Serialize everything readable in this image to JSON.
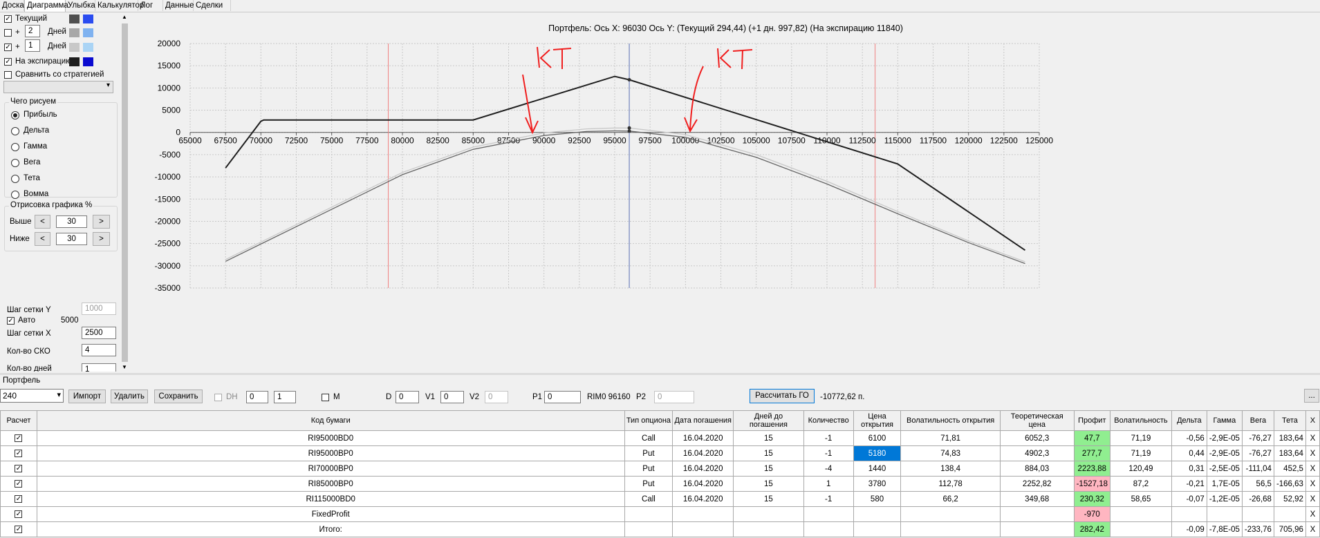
{
  "tabs": [
    "Доска",
    "Диаграмма",
    "Улыбка",
    "Калькулятор",
    "Лог",
    "Данные",
    "Сделки"
  ],
  "active_tab": "Диаграмма",
  "left": {
    "current_label": "Текущий",
    "plus": "+",
    "days_label": "Дней",
    "days1": "2",
    "days2": "1",
    "expiry_label": "На экспирацию",
    "compare_label": "Сравнить со стратегией",
    "what_title": "Чего рисуем",
    "radios": [
      "Прибыль",
      "Дельта",
      "Гамма",
      "Вега",
      "Тета",
      "Вомма"
    ],
    "draw_title": "Отрисовка графика %",
    "above_label": "Выше",
    "below_label": "Ниже",
    "above_value": "30",
    "below_value": "30",
    "left_arrow": "<",
    "right_arrow": ">",
    "grid_y_label": "Шаг сетки Y",
    "grid_y_value": "1000",
    "auto_label": "Авто",
    "auto_value": "5000",
    "grid_x_label": "Шаг сетки X",
    "grid_x_value": "2500",
    "sko_label": "Кол-во СКО",
    "sko_value": "4",
    "days_count_label": "Кол-во дней",
    "days_count_value": "1",
    "colors": {
      "current_dark": "#505050",
      "current_light": "#2a4cf0",
      "days2_dark": "#a8a8a8",
      "days2_light": "#7fb2f0",
      "days1_dark": "#c8c8c8",
      "days1_light": "#aad4f5",
      "expiry_dark": "#1e1e1e",
      "expiry_light": "#0a0ad0"
    }
  },
  "chart": {
    "title": "Портфель: Ось X: 96030 Ось Y:  (Текущий 294,44)  (+1 дн. 997,82)  (На экспирацию 11840)",
    "annotations": [
      "KT",
      "KT"
    ]
  },
  "chart_data": {
    "type": "line",
    "xlim": [
      65000,
      125000
    ],
    "ylim": [
      -35000,
      20000
    ],
    "x_ticks": [
      65000,
      67500,
      70000,
      72500,
      75000,
      77500,
      80000,
      82500,
      85000,
      87500,
      90000,
      92500,
      95000,
      97500,
      100000,
      102500,
      105000,
      107500,
      110000,
      112500,
      115000,
      117500,
      120000,
      122500,
      125000
    ],
    "y_ticks": [
      20000,
      15000,
      10000,
      5000,
      0,
      -5000,
      -10000,
      -15000,
      -20000,
      -25000,
      -30000,
      -35000
    ],
    "cursor_x": 96030,
    "red_lines_x": [
      79000,
      113400
    ],
    "series": [
      {
        "color": "#1e1e1e",
        "x": [
          67500,
          70000,
          70200,
          85000,
          95000,
          96030,
          115000,
          124000
        ],
        "y": [
          -8000,
          2500,
          2800,
          2800,
          12600,
          11840,
          -7100,
          -26500
        ]
      },
      {
        "color": "#646464",
        "x": [
          67500,
          75000,
          80000,
          85000,
          90000,
          93000,
          95000,
          96030,
          100000,
          105000,
          110000,
          115000,
          120000,
          124000
        ],
        "y": [
          -29000,
          -17300,
          -9500,
          -3800,
          -700,
          200,
          350,
          294,
          -1100,
          -5600,
          -11600,
          -18300,
          -24800,
          -29500
        ]
      },
      {
        "color": "#c8c8c8",
        "x": [
          67500,
          75000,
          80000,
          85000,
          90000,
          93000,
          95000,
          96030,
          100000,
          105000,
          110000,
          115000,
          120000,
          124000
        ],
        "y": [
          -28600,
          -16800,
          -9000,
          -3300,
          -100,
          800,
          1000,
          998,
          -500,
          -5000,
          -11000,
          -17800,
          -24400,
          -29100
        ]
      }
    ]
  },
  "portfolio": {
    "label": "Портфель",
    "selected": "240",
    "import": "Импорт",
    "delete": "Удалить",
    "save": "Сохранить",
    "dh": "DH",
    "spin1": "0",
    "spin2": "1",
    "m": "M",
    "d": "D",
    "d_val": "0",
    "v1": "V1",
    "v1_val": "0",
    "v2": "V2",
    "v2_val": "0",
    "p1": "P1",
    "p1_val": "0",
    "rim": "RIM0 96160",
    "p2": "P2",
    "p2_val": "0",
    "calc_go": "Рассчитать ГО",
    "go_value": "-10772,62 п.",
    "more": "..."
  },
  "table": {
    "headers": [
      "Расчет",
      "Код бумаги",
      "Тип опциона",
      "Дата погашения",
      "Дней до погашения",
      "Количество",
      "Цена открытия",
      "Волатильность открытия",
      "Теоретическая цена",
      "Профит",
      "Волатильность",
      "Дельта",
      "Гамма",
      "Вега",
      "Тета",
      "X"
    ],
    "rows": [
      [
        "RI95000BD0",
        "Call",
        "16.04.2020",
        "15",
        "-1",
        "6100",
        "71,81",
        "6052,3",
        "47,7",
        "71,19",
        "-0,56",
        "-2,9E-05",
        "-76,27",
        "183,64",
        "X"
      ],
      [
        "RI95000BP0",
        "Put",
        "16.04.2020",
        "15",
        "-1",
        "5180",
        "74,83",
        "4902,3",
        "277,7",
        "71,19",
        "0,44",
        "-2,9E-05",
        "-76,27",
        "183,64",
        "X"
      ],
      [
        "RI70000BP0",
        "Put",
        "16.04.2020",
        "15",
        "-4",
        "1440",
        "138,4",
        "884,03",
        "2223,88",
        "120,49",
        "0,31",
        "-2,5E-05",
        "-111,04",
        "452,5",
        "X"
      ],
      [
        "RI85000BP0",
        "Put",
        "16.04.2020",
        "15",
        "1",
        "3780",
        "112,78",
        "2252,82",
        "-1527,18",
        "87,2",
        "-0,21",
        "1,7E-05",
        "56,5",
        "-166,63",
        "X"
      ],
      [
        "RI115000BD0",
        "Call",
        "16.04.2020",
        "15",
        "-1",
        "580",
        "66,2",
        "349,68",
        "230,32",
        "58,65",
        "-0,07",
        "-1,2E-05",
        "-26,68",
        "52,92",
        "X"
      ],
      [
        "FixedProfit",
        "",
        "",
        "",
        "",
        "",
        "",
        "",
        "-970",
        "",
        "",
        "",
        "",
        "",
        "X"
      ],
      [
        "Итого:",
        "",
        "",
        "",
        "",
        "",
        "",
        "",
        "282,42",
        "",
        "-0,09",
        "-7,8E-05",
        "-233,76",
        "705,96",
        "X"
      ]
    ],
    "profit_state": [
      "pos",
      "pos",
      "pos",
      "neg",
      "pos",
      "neg",
      "pos"
    ],
    "check": "✓"
  }
}
